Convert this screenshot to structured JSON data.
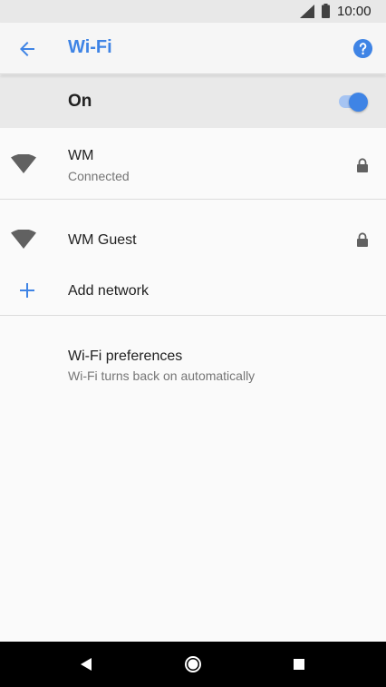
{
  "status_bar": {
    "time": "10:00",
    "signal_icon": "cellular-signal-icon",
    "battery_icon": "battery-icon"
  },
  "app_bar": {
    "title": "Wi-Fi",
    "back_icon": "arrow-back-icon",
    "help_icon": "help-icon",
    "accent_color": "#3f84e5"
  },
  "master_switch": {
    "label": "On",
    "state": "on"
  },
  "networks": [
    {
      "name": "WM",
      "status": "Connected",
      "secured": true
    },
    {
      "name": "WM Guest",
      "status": "",
      "secured": true
    }
  ],
  "add_network": {
    "label": "Add network",
    "icon": "plus-icon"
  },
  "preferences": {
    "title": "Wi-Fi preferences",
    "subtitle": "Wi-Fi turns back on automatically"
  },
  "nav_bar": {
    "back_icon": "nav-back-icon",
    "home_icon": "nav-home-icon",
    "recents_icon": "nav-recents-icon"
  }
}
